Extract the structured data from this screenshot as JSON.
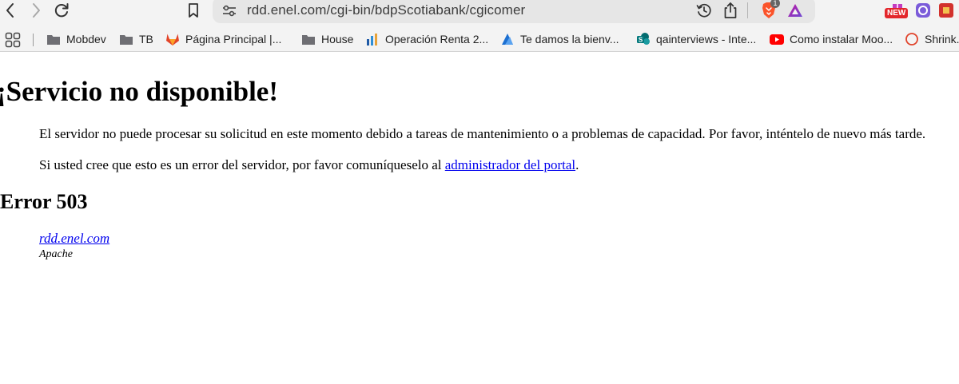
{
  "browser": {
    "url": "rdd.enel.com/cgi-bin/bdpScotiabank/cgicomer",
    "brave_badge_count": "1",
    "new_badge": "NEW"
  },
  "bookmarks": [
    {
      "label": "Mobdev",
      "icon": "folder-icon"
    },
    {
      "label": "TB",
      "icon": "folder-icon"
    },
    {
      "label": "Página Principal |...",
      "icon": "gitlab-icon"
    },
    {
      "label": "House",
      "icon": "folder-icon"
    },
    {
      "label": "Operación Renta 2...",
      "icon": "sii-icon"
    },
    {
      "label": "Te damos la bienv...",
      "icon": "azure-devops-icon"
    },
    {
      "label": "qainterviews - Inte...",
      "icon": "sharepoint-icon"
    },
    {
      "label": "Como instalar Moo...",
      "icon": "youtube-icon"
    },
    {
      "label": "Shrink...",
      "icon": "circle-icon"
    }
  ],
  "page": {
    "title": "¡Servicio no disponible!",
    "message": "El servidor no puede procesar su solicitud en este momento debido a tareas de mantenimiento o a problemas de capacidad. Por favor, inténtelo de nuevo más tarde.",
    "contact_prefix": "Si usted cree que esto es un error del servidor, por favor comuníqueselo al ",
    "contact_link": "administrador del portal",
    "contact_suffix": ".",
    "error_heading": "Error 503",
    "server_host": "rdd.enel.com",
    "server_software": "Apache"
  }
}
